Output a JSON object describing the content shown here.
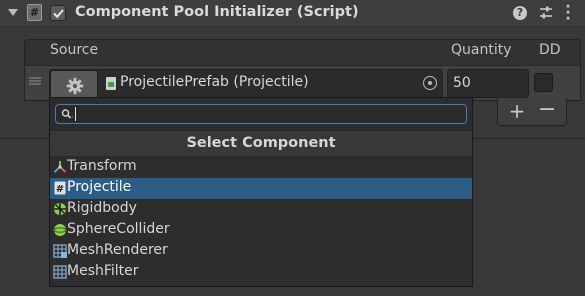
{
  "component": {
    "title": "Component Pool Initializer (Script)",
    "enabled": true,
    "script_icon_glyph": "#"
  },
  "list": {
    "columns": {
      "source": "Source",
      "quantity": "Quantity",
      "dd": "DD"
    },
    "rows": [
      {
        "source_value": "ProjectilePrefab (Projectile)",
        "quantity": "50",
        "dd": false
      }
    ],
    "add_label": "+",
    "remove_label": "−"
  },
  "popup": {
    "search_value": "",
    "title": "Select Component",
    "items": [
      {
        "label": "Transform",
        "icon": "transform-icon",
        "selected": false
      },
      {
        "label": "Projectile",
        "icon": "script-icon",
        "selected": true
      },
      {
        "label": "Rigidbody",
        "icon": "rigidbody-icon",
        "selected": false
      },
      {
        "label": "SphereCollider",
        "icon": "sphere-collider-icon",
        "selected": false
      },
      {
        "label": "MeshRenderer",
        "icon": "mesh-renderer-icon",
        "selected": false
      },
      {
        "label": "MeshFilter",
        "icon": "mesh-filter-icon",
        "selected": false
      }
    ]
  },
  "colors": {
    "background": "#383838",
    "selection": "#2c5d87",
    "search_focus": "#4a7ab5"
  }
}
